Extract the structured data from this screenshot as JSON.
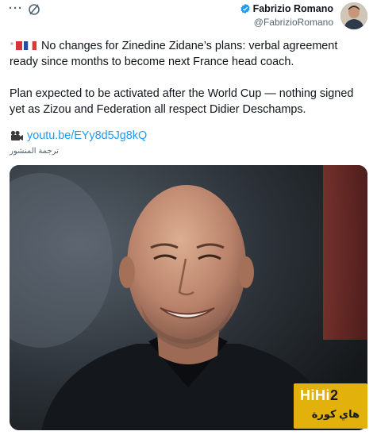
{
  "header": {
    "more_icon": "more-horizontal-icon",
    "grok_icon": "grok-slash-icon",
    "author_name": "Fabrizio Romano",
    "author_handle": "@FabrizioRomano",
    "verified_icon": "verified-badge-icon",
    "verified_color": "#1d9bf0"
  },
  "tweet": {
    "flags": [
      "malta-flag-icon",
      "france-flag-icon"
    ],
    "paragraph_1": "No changes for Zinedine Zidane’s plans: verbal agreement ready since months to become next France head coach.",
    "paragraph_2": "Plan expected to be activated after the World Cup — nothing signed yet as Zizou and Federation all respect Didier Deschamps.",
    "link_icon": "video-camera-icon",
    "link_text": "youtu.be/EYy8d5Jg8kQ",
    "link_color": "#1d9bf0",
    "translate_label": "ترجمة المنشور"
  },
  "media": {
    "alt_subject": "photo",
    "watermark": {
      "title_part1": "HiHi",
      "title_part2": "2",
      "subtitle": "هاي كورة",
      "bg_color": "#e2b10c"
    }
  }
}
